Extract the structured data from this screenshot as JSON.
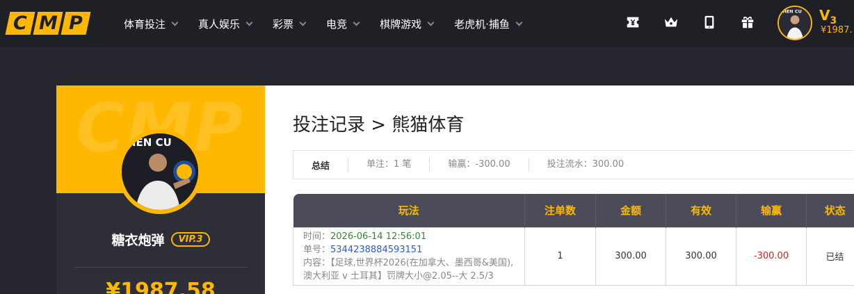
{
  "logo": {
    "letters": [
      "C",
      "M",
      "P"
    ]
  },
  "nav": {
    "items": [
      "体育投注",
      "真人娱乐",
      "彩票",
      "电竞",
      "棋牌游戏",
      "老虎机·捕鱼"
    ]
  },
  "top_icons": [
    "yen-ticket-icon",
    "crown-icon",
    "tablet-icon",
    "gift-icon"
  ],
  "user": {
    "avatar_text": "HEN CU",
    "vip_label": "V",
    "vip_level": "3",
    "balance_short": "¥1987.",
    "name": "糖衣炮弹",
    "vip_badge": "VIP.3",
    "balance_big": "¥1987.58"
  },
  "profile": {
    "watermark": "CMP"
  },
  "page": {
    "title": "投注记录 > 熊猫体育"
  },
  "summary": {
    "title": "总结",
    "count": "单注：1 笔",
    "win_loss": "输赢：-300.00",
    "turnover": "投注流水：300.00"
  },
  "table": {
    "headers": [
      "玩法",
      "注单数",
      "金额",
      "有效",
      "输赢",
      "状态"
    ],
    "rows": [
      {
        "time_label": "时间：",
        "time_value": "2026-06-14 12:56:01",
        "order_label": "单号：",
        "order_value": "5344238884593151",
        "content_label": "内容：",
        "content_value": "【足球,世界杯2026(在加拿大、墨西哥&美国),澳大利亚 v 土耳其】罚牌大小@2.05--大 2.5/3",
        "count": "1",
        "amount": "300.00",
        "valid": "300.00",
        "win_loss": "-300.00",
        "status": "已结"
      }
    ]
  },
  "colors": {
    "accent": "#ffb800",
    "nav_bg": "#1f1f26",
    "page_bg": "#26262f",
    "table_header": "#4c4b59",
    "loss": "#e02020"
  }
}
